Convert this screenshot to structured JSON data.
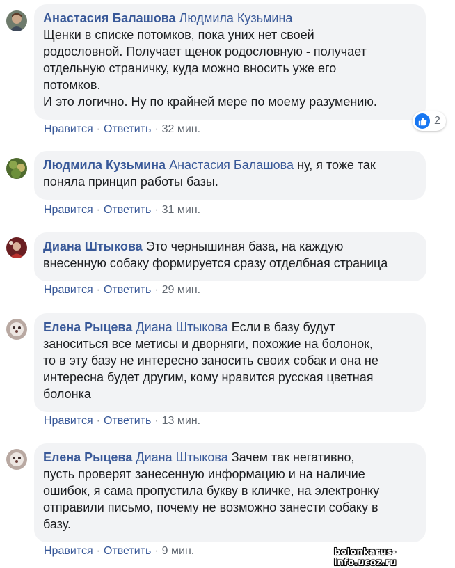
{
  "comments": [
    {
      "author": "Анастасия Балашова",
      "reply_to": "Людмила Кузьмина",
      "lines": [
        "Щенки в списке потомков, пока уних нет своей",
        "родословной. Получает щенок родословную - получает",
        "отдельную страничку, куда можно вносить уже его",
        "потомков.",
        "И это логично. Ну по крайней мере по моему разумению."
      ],
      "like_label": "Нравится",
      "reply_label": "Ответить",
      "time": "32 мин.",
      "reactions": {
        "count": "2",
        "icon": "like-icon",
        "color": "#1877f2"
      }
    },
    {
      "author": "Людмила Кузьмина",
      "reply_to": "Анастасия Балашова",
      "lines": [
        "ну, я тоже так",
        "поняла принцип работы базы."
      ],
      "like_label": "Нравится",
      "reply_label": "Ответить",
      "time": "31 мин."
    },
    {
      "author": "Диана Штыкова",
      "reply_to": "",
      "lines": [
        "Это чернышиная база, на каждую",
        "внесенную собаку формируется сразу отделбная страница"
      ],
      "like_label": "Нравится",
      "reply_label": "Ответить",
      "time": "29 мин."
    },
    {
      "author": "Елена Рыцева",
      "reply_to": "Диана Штыкова",
      "lines": [
        "Если в базу будут",
        "заноситься все метисы и дворняги, похожие на болонок,",
        "то в эту базу не интересно заносить своих собак и она не",
        "интересна будет другим, кому нравится русская цветная",
        "болонка"
      ],
      "like_label": "Нравится",
      "reply_label": "Ответить",
      "time": "13 мин."
    },
    {
      "author": "Елена Рыцева",
      "reply_to": "Диана Штыкова",
      "lines": [
        "Зачем так негативно,",
        "пусть проверят занесенную информацию и на наличие",
        "ошибок, я сама пропустила букву в кличке, на электронку",
        "отправили письмо, почему не возможно занести собаку в",
        "базу."
      ],
      "like_label": "Нравится",
      "reply_label": "Ответить",
      "time": "9 мин."
    }
  ],
  "separator": "·",
  "watermark": "bolonkarus-info.ucoz.ru",
  "colors": {
    "name": "#385898",
    "bubble": "#f2f3f5",
    "meta": "#606770"
  }
}
